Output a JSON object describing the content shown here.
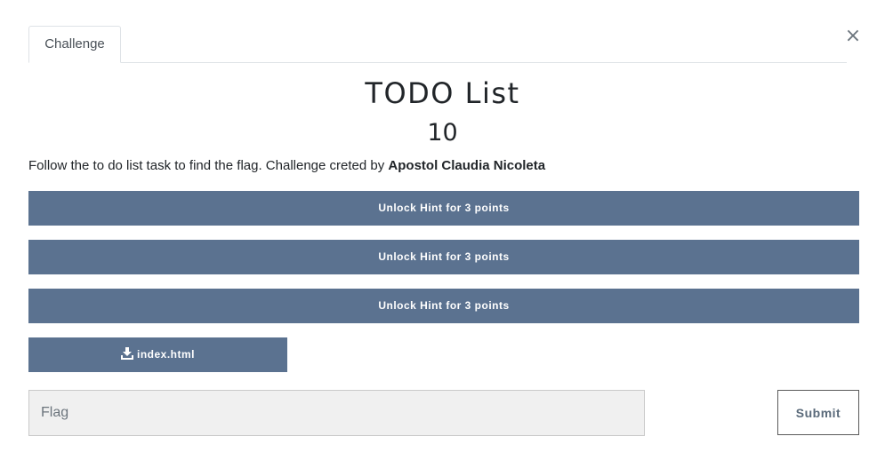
{
  "modal": {
    "close_label": "×"
  },
  "tabs": [
    {
      "label": "Challenge"
    }
  ],
  "challenge": {
    "title": "TODO List",
    "points": "10",
    "description_text": "Follow the to do list task to find the flag. Challenge creted by ",
    "author": "Apostol Claudia Nicoleta"
  },
  "hints": [
    {
      "label": "Unlock Hint for 3 points"
    },
    {
      "label": "Unlock Hint for 3 points"
    },
    {
      "label": "Unlock Hint for 3 points"
    }
  ],
  "files": [
    {
      "name": "index.html",
      "icon": "download-icon"
    }
  ],
  "flag_form": {
    "placeholder": "Flag",
    "value": "",
    "submit_label": "Submit"
  },
  "colors": {
    "button_bg": "#5b7290",
    "input_bg": "#f0f0f0"
  }
}
